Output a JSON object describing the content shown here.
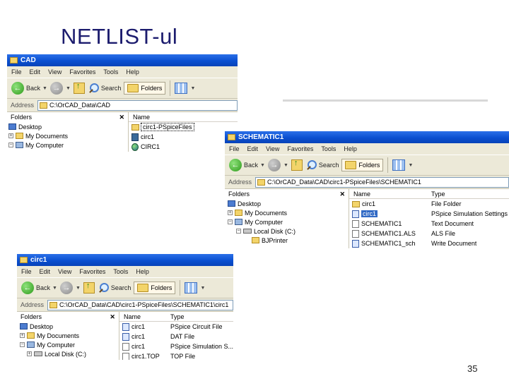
{
  "slide": {
    "title": "NETLIST-ul",
    "page_number": "35"
  },
  "windows": {
    "cad": {
      "title": "CAD",
      "menu": [
        "File",
        "Edit",
        "View",
        "Favorites",
        "Tools",
        "Help"
      ],
      "toolbar": {
        "back": "Back",
        "search": "Search",
        "folders": "Folders"
      },
      "address_label": "Address",
      "address": "C:\\OrCAD_Data\\CAD",
      "folders_label": "Folders",
      "name_header": "Name",
      "tree": [
        "Desktop",
        "My Documents",
        "My Computer"
      ],
      "files": [
        "circ1-PSpiceFiles",
        "circ1",
        "CIRC1"
      ]
    },
    "schematic": {
      "title": "SCHEMATIC1",
      "menu": [
        "File",
        "Edit",
        "View",
        "Favorites",
        "Tools",
        "Help"
      ],
      "toolbar": {
        "back": "Back",
        "search": "Search",
        "folders": "Folders"
      },
      "address_label": "Address",
      "address": "C:\\OrCAD_Data\\CAD\\circ1-PSpiceFiles\\SCHEMATIC1",
      "folders_label": "Folders",
      "name_header": "Name",
      "type_header": "Type",
      "tree": [
        "Desktop",
        "My Documents",
        "My Computer",
        "Local Disk (C:)",
        "BJPrinter"
      ],
      "files": [
        {
          "name": "circ1",
          "type": "File Folder"
        },
        {
          "name": "circ1",
          "type": "PSpice Simulation Settings"
        },
        {
          "name": "SCHEMATIC1",
          "type": "Text Document"
        },
        {
          "name": "SCHEMATIC1.ALS",
          "type": "ALS File"
        },
        {
          "name": "SCHEMATIC1_sch",
          "type": "Write Document"
        }
      ]
    },
    "circ1": {
      "title": "circ1",
      "menu": [
        "File",
        "Edit",
        "View",
        "Favorites",
        "Tools",
        "Help"
      ],
      "toolbar": {
        "back": "Back",
        "search": "Search",
        "folders": "Folders"
      },
      "address_label": "Address",
      "address": "C:\\OrCAD_Data\\CAD\\circ1-PSpiceFiles\\SCHEMATIC1\\circ1",
      "folders_label": "Folders",
      "name_header": "Name",
      "type_header": "Type",
      "tree": [
        "Desktop",
        "My Documents",
        "My Computer",
        "Local Disk (C:)"
      ],
      "files": [
        {
          "name": "circ1",
          "type": "PSpice Circuit File"
        },
        {
          "name": "circ1",
          "type": "DAT File"
        },
        {
          "name": "circ1",
          "type": "PSpice Simulation S..."
        },
        {
          "name": "circ1.TOP",
          "type": "TOP File"
        }
      ]
    }
  }
}
